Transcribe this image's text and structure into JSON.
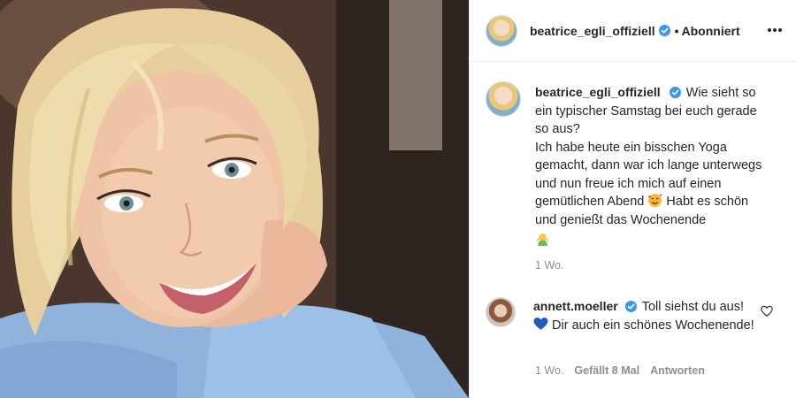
{
  "header": {
    "username": "beatrice_egli_offiziell",
    "separator": "•",
    "follow_status": "Abonniert"
  },
  "caption": {
    "username": "beatrice_egli_offiziell",
    "text": "Wie sieht so ein typischer Samstag bei euch gerade so aus?\nIch habe heute ein bisschen Yoga gemacht, dann war ich lange unterwegs und nun freue ich mich auf einen gemütlichen Abend",
    "text_after_emoji": " Habt es schön und genießt das Wochenende",
    "time": "1 Wo."
  },
  "comment": {
    "username": "annett.moeller",
    "text_before_emoji": "Toll siehst du aus!",
    "text_after_emoji": " Dir auch ein schönes Wochenende!",
    "time": "1 Wo.",
    "likes": "Gefällt 8 Mal",
    "reply_label": "Antworten"
  },
  "icons": {
    "verified": "verified-badge-icon",
    "more": "more-horizontal-icon",
    "heart": "heart-outline-icon",
    "emoji_smiling_hearts": "smiling-face-with-hearts-emoji",
    "emoji_person": "person-emoji",
    "emoji_blue_heart": "blue-heart-emoji"
  },
  "colors": {
    "verified_blue": "#3897f0",
    "text": "#262626",
    "muted": "#8e8e8e",
    "heart_blue": "#1f5bb8"
  }
}
